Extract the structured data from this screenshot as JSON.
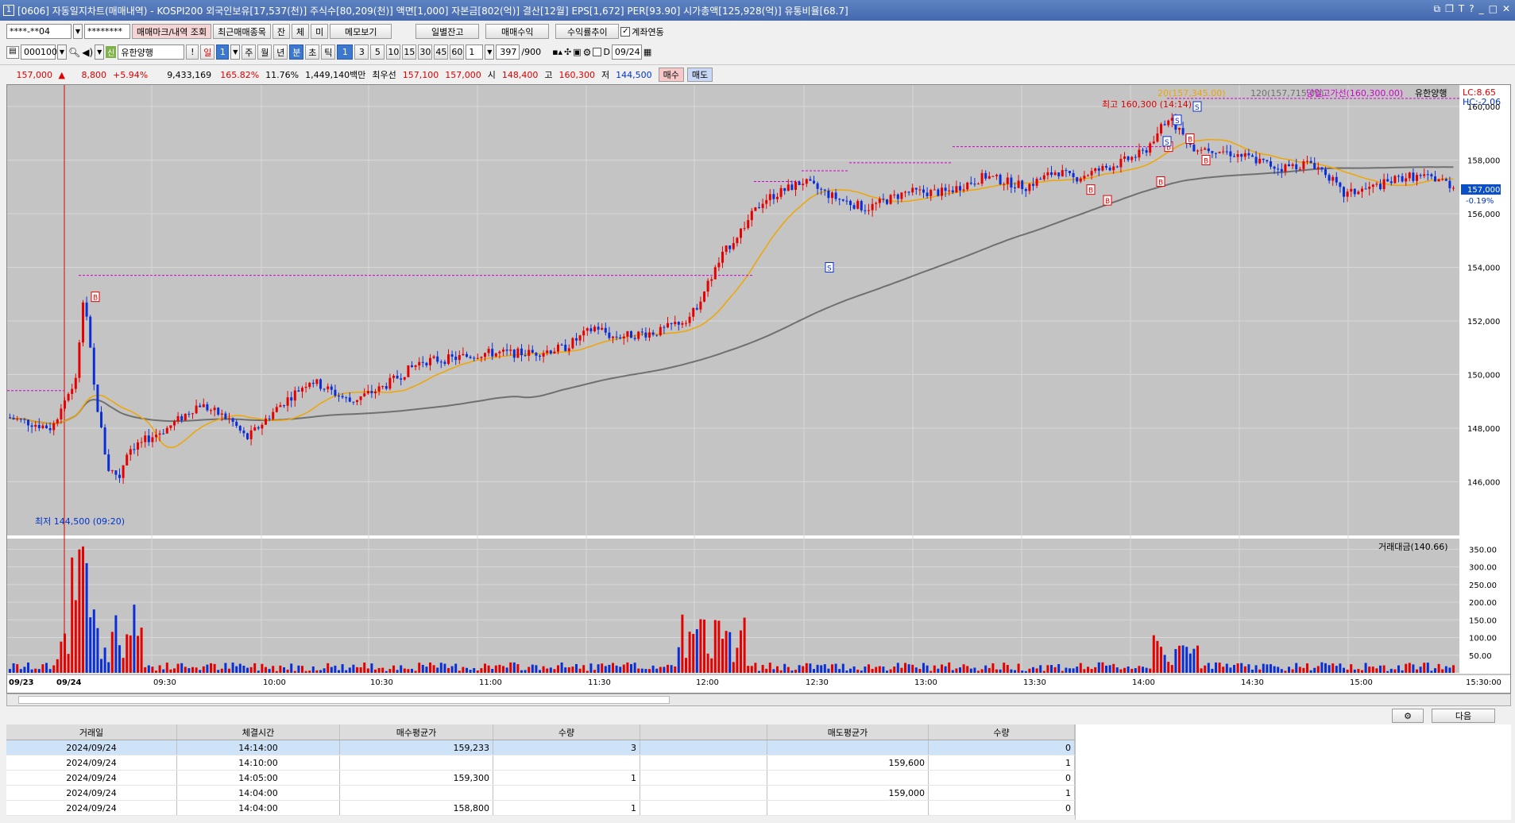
{
  "window": {
    "title": "[0606] 자동일지차트(매매내역) - KOSPI200 외국인보유[17,537(천)] 주식수[80,209(천)] 액면[1,000] 자본금[802(억)] 결산[12월] EPS[1,672] PER[93.90] 시가총액[125,928(억)] 유통비율[68.7]",
    "icon": "1"
  },
  "toolbar": {
    "account": "****-**04",
    "password": "********",
    "btn_trade_mark": "매매마크/내역 조회",
    "btn_recent_items": "최근매매종목",
    "btn_jan": "잔",
    "btn_che": "체",
    "btn_mi": "미",
    "btn_memo": "메모보기",
    "btn_daily_balance": "일별잔고",
    "btn_trade_profit": "매매수익",
    "btn_profit_trend": "수익률추이",
    "link_account_label": "계좌연동",
    "code": "000100",
    "stock_name": "유한양행",
    "period_buttons": [
      "!",
      "일",
      "1"
    ],
    "period_types": [
      "주",
      "월",
      "년",
      "분",
      "초",
      "틱"
    ],
    "minutes": [
      "1",
      "3",
      "5",
      "10",
      "15",
      "30",
      "45",
      "60"
    ],
    "interval": "1",
    "count": "397",
    "count_max": "/900",
    "date_label": "D",
    "date": "09/24"
  },
  "quote": {
    "price": "157,000",
    "change": "8,800",
    "change_pct": "+5.94%",
    "volume": "9,433,169",
    "vol_ratio": "165.82%",
    "turnover": "11.76%",
    "amount": "1,449,140백만",
    "best_label": "최우선",
    "best_ask": "157,100",
    "best_bid": "157,000",
    "open_label": "시",
    "open": "148,400",
    "high_label": "고",
    "high": "160,300",
    "low_label": "저",
    "low": "144,500",
    "buy_btn": "매수",
    "sell_btn": "매도"
  },
  "chart": {
    "legend_ma20": "20(157,345.00)",
    "legend_ma120": "120(157,715.00)",
    "legend_dayhigh": "당일고가선(160,300.00)",
    "legend_name": "유한양행",
    "lc": "LC:8.65",
    "hc": "HC:-2.06",
    "high_annotation": "최고 160,300 (14:14)",
    "low_annotation": "최저 144,500 (09:20)",
    "current_price_tag": "157,000",
    "current_change_tag": "-0.19%",
    "price_ticks": [
      "160,000",
      "158,000",
      "156,000",
      "154,000",
      "152,000",
      "150,000",
      "148,000",
      "146,000"
    ],
    "volume_legend": "거래대금(140.66)",
    "volume_ticks": [
      "350.00",
      "300.00",
      "250.00",
      "200.00",
      "150.00",
      "100.00",
      "50.00"
    ],
    "time_labels": [
      "09/23",
      "09/24",
      "09:30",
      "10:00",
      "10:30",
      "11:00",
      "11:30",
      "12:00",
      "12:30",
      "13:00",
      "13:30",
      "14:00",
      "14:30",
      "15:00",
      "15:30:00"
    ],
    "colors": {
      "up": "#e60000",
      "down": "#0a2fd8",
      "ma_short": "#f0a500",
      "ma_long": "#707070",
      "dayhigh": "#d000d0"
    },
    "buy_marker": "B",
    "sell_marker": "S"
  },
  "actions": {
    "settings_icon": "gear-icon",
    "next_btn": "다음"
  },
  "table": {
    "headers": [
      "거래일",
      "체결시간",
      "매수평균가",
      "수량",
      "",
      "매도평균가",
      "수량"
    ],
    "rows": [
      [
        "2024/09/24",
        "14:14:00",
        "159,233",
        "3",
        "",
        "",
        "0"
      ],
      [
        "2024/09/24",
        "14:10:00",
        "",
        "",
        "",
        "159,600",
        "1"
      ],
      [
        "2024/09/24",
        "14:05:00",
        "159,300",
        "1",
        "",
        "",
        "0"
      ],
      [
        "2024/09/24",
        "14:04:00",
        "",
        "",
        "",
        "159,000",
        "1"
      ],
      [
        "2024/09/24",
        "14:04:00",
        "158,800",
        "1",
        "",
        "",
        "0"
      ]
    ]
  }
}
